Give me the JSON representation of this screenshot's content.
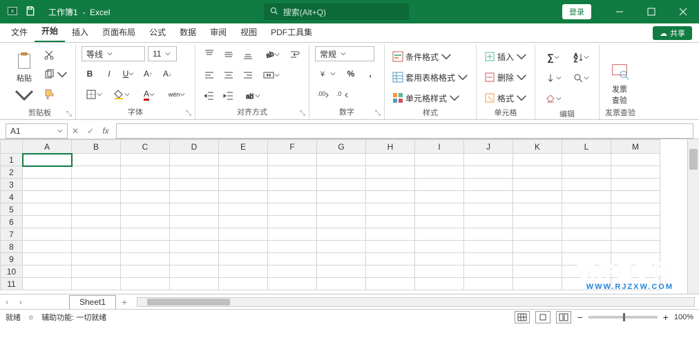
{
  "title": {
    "workbook": "工作簿1",
    "app": "Excel"
  },
  "search": {
    "placeholder": "搜索(Alt+Q)"
  },
  "login": "登录",
  "tabs": [
    "文件",
    "开始",
    "插入",
    "页面布局",
    "公式",
    "数据",
    "审阅",
    "视图",
    "PDF工具集"
  ],
  "active_tab": "开始",
  "share": "共享",
  "ribbon": {
    "clipboard": {
      "paste": "粘贴",
      "label": "剪贴板"
    },
    "font": {
      "name": "等线",
      "size": "11",
      "label": "字体",
      "wen": "wén"
    },
    "align": {
      "label": "对齐方式"
    },
    "number": {
      "format": "常规",
      "label": "数字"
    },
    "styles": {
      "cond": "条件格式",
      "tablefmt": "套用表格格式",
      "cellstyle": "单元格样式",
      "label": "样式"
    },
    "cells": {
      "insert": "插入",
      "delete": "删除",
      "format": "格式",
      "label": "单元格"
    },
    "editing": {
      "label": "编辑"
    },
    "invoice": {
      "btn": "发票\n查验",
      "label": "发票查验"
    }
  },
  "namebox": "A1",
  "cols": [
    "A",
    "B",
    "C",
    "D",
    "E",
    "F",
    "G",
    "H",
    "I",
    "J",
    "K",
    "L",
    "M"
  ],
  "rows": [
    "1",
    "2",
    "3",
    "4",
    "5",
    "6",
    "7",
    "8",
    "9",
    "10",
    "11"
  ],
  "sheet": "Sheet1",
  "status": {
    "ready": "就绪",
    "access": "辅助功能: 一切就绪",
    "zoom": "100%"
  },
  "watermark": {
    "big": "软件自学网",
    "small": "WWW.RJZXW.COM"
  }
}
